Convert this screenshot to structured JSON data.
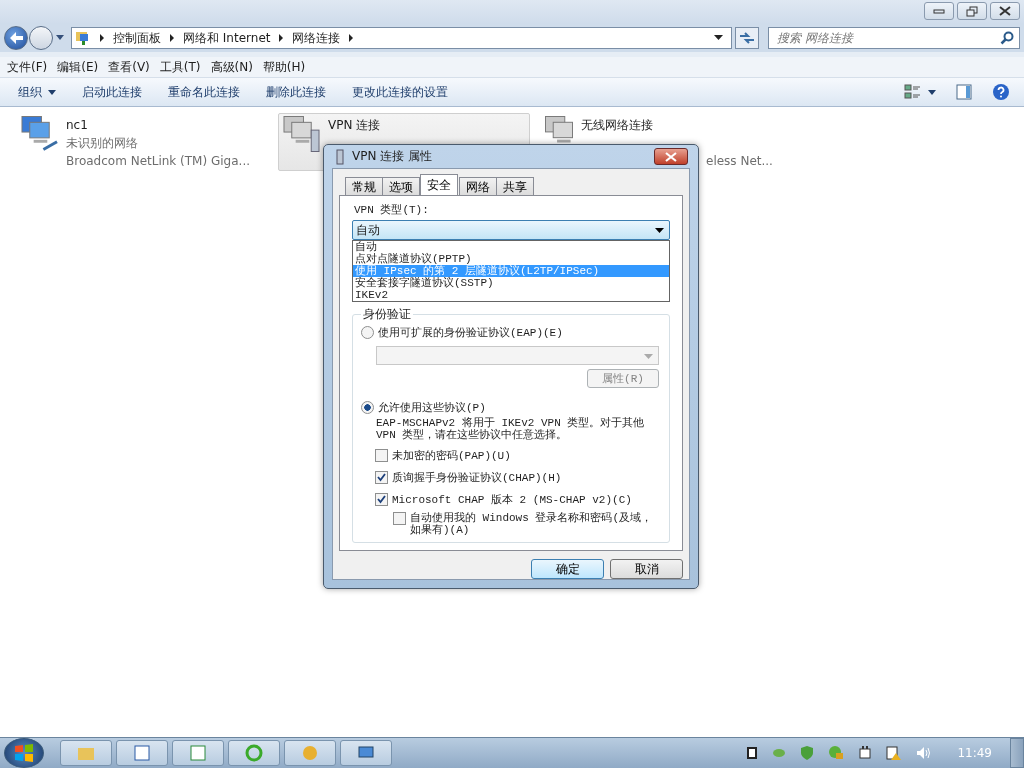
{
  "window": {
    "breadcrumb": [
      "控制面板",
      "网络和 Internet",
      "网络连接"
    ],
    "search": {
      "placeholder": "搜索 网络连接"
    }
  },
  "menu": [
    "文件(F)",
    "编辑(E)",
    "查看(V)",
    "工具(T)",
    "高级(N)",
    "帮助(H)"
  ],
  "toolbar": [
    {
      "label": "组织",
      "kind": "dropdown"
    },
    {
      "label": "启动此连接",
      "kind": "plain"
    },
    {
      "label": "重命名此连接",
      "kind": "plain"
    },
    {
      "label": "删除此连接",
      "kind": "plain"
    },
    {
      "label": "更改此连接的设置",
      "kind": "plain"
    }
  ],
  "connections": [
    {
      "name": "nc1",
      "status": "未识别的网络",
      "device": "Broadcom NetLink (TM) Giga...",
      "selected": false,
      "kind": "wired"
    },
    {
      "name": "VPN 连接",
      "selected": true,
      "kind": "vpn"
    },
    {
      "name": "无线网络连接",
      "device": "eless Net...",
      "selected": false,
      "kind": "wireless"
    }
  ],
  "dialog": {
    "title": "VPN 连接 属性",
    "tabs": [
      {
        "label": "常规",
        "selected": false
      },
      {
        "label": "选项",
        "selected": false
      },
      {
        "label": "安全",
        "selected": true
      },
      {
        "label": "网络",
        "selected": false
      },
      {
        "label": "共享",
        "selected": false
      }
    ],
    "vpn_type_label": "VPN 类型(T):",
    "vpn_type_value": "自动",
    "vpn_type_options": [
      {
        "label": "自动",
        "selected": false
      },
      {
        "label": "点对点隧道协议(PPTP)",
        "selected": false
      },
      {
        "label": "使用 IPsec 的第 2 层隧道协议(L2TP/IPSec)",
        "selected": true
      },
      {
        "label": "安全套接字隧道协议(SSTP)",
        "selected": false
      },
      {
        "label": "IKEv2",
        "selected": false
      }
    ],
    "auth_group": "身份验证",
    "eap_radio": {
      "label": "使用可扩展的身份验证协议(EAP)(E)",
      "selected": false
    },
    "eap_properties_button": "属性(R)",
    "allow_radio": {
      "label": "允许使用这些协议(P)",
      "selected": true
    },
    "allow_note": "EAP-MSCHAPv2 将用于 IKEv2 VPN 类型。对于其他 VPN 类型，请在这些协议中任意选择。",
    "protocols": [
      {
        "label": "未加密的密码(PAP)(U)",
        "checked": false
      },
      {
        "label": "质询握手身份验证协议(CHAP)(H)",
        "checked": true
      },
      {
        "label": "Microsoft CHAP 版本 2 (MS-CHAP v2)(C)",
        "checked": true,
        "children": [
          {
            "label": "自动使用我的 Windows 登录名称和密码(及域，如果有)(A)",
            "checked": false
          }
        ]
      }
    ],
    "buttons": [
      {
        "label": "确定",
        "kind": "default"
      },
      {
        "label": "取消",
        "kind": "normal"
      }
    ]
  },
  "taskbar": {
    "clock": "11:49"
  }
}
